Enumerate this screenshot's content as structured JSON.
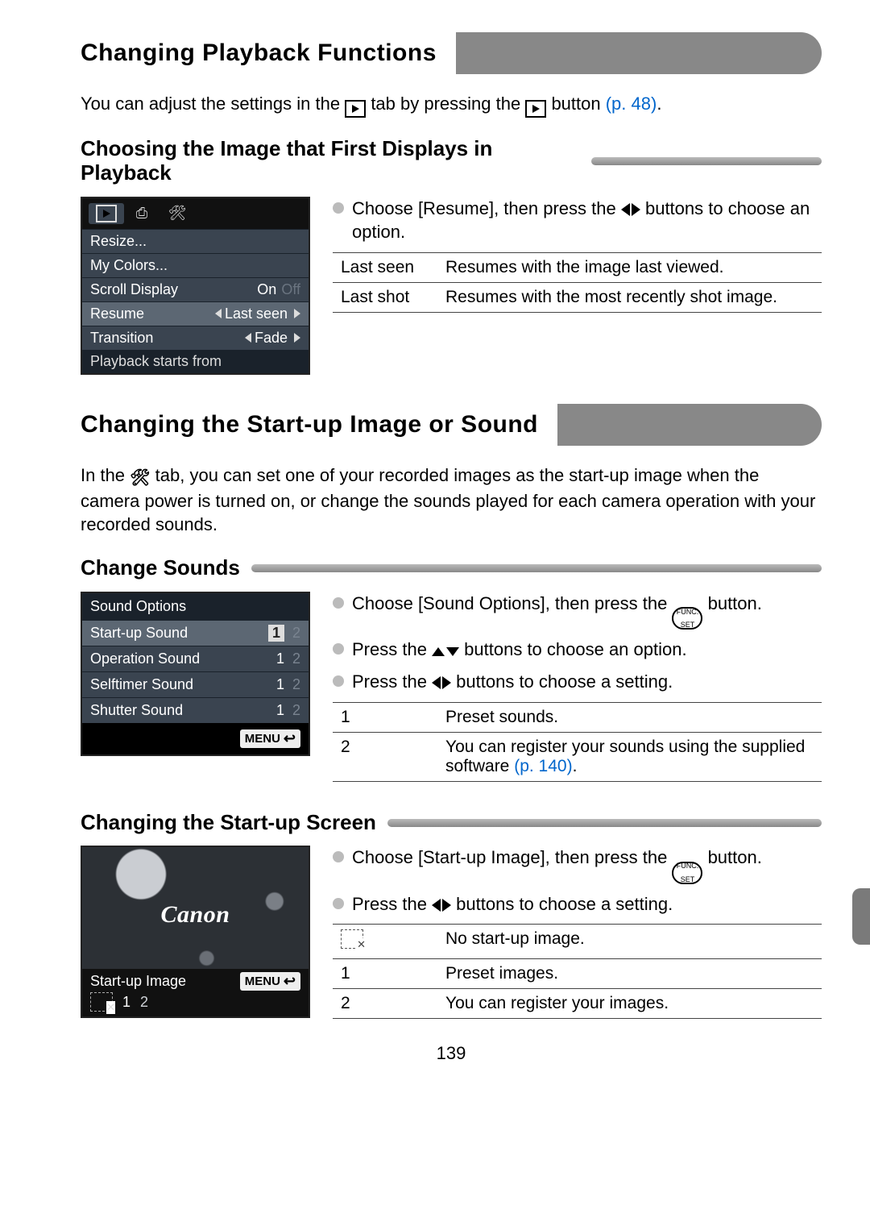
{
  "page_number": "139",
  "section1": {
    "title": "Changing Playback Functions",
    "intro_a": "You can adjust the settings in the ",
    "intro_b": " tab by pressing the ",
    "intro_c": " button ",
    "intro_ref": "(p. 48)",
    "intro_d": "."
  },
  "sub1": {
    "title": "Choosing the Image that First Displays in Playback",
    "bullet_a": "Choose [Resume], then press the ",
    "bullet_b": " buttons to choose an option.",
    "table": [
      {
        "k": "Last seen",
        "v": "Resumes with the image last viewed."
      },
      {
        "k": "Last shot",
        "v": "Resumes with the most recently shot image."
      }
    ],
    "cam": {
      "rows": [
        {
          "label": "Resize...",
          "value": ""
        },
        {
          "label": "My Colors...",
          "value": ""
        },
        {
          "label": "Scroll Display",
          "value_on": "On",
          "value_off": "Off"
        },
        {
          "label": "Resume",
          "value": "Last seen",
          "selected": true,
          "arrows": true
        },
        {
          "label": "Transition",
          "value": "Fade",
          "arrows": true
        }
      ],
      "status": "Playback starts from"
    }
  },
  "section2": {
    "title": "Changing the Start-up Image or Sound",
    "intro_a": "In the ",
    "intro_b": " tab, you can set one of your recorded images as the start-up image when the camera power is turned on, or change the sounds played for each camera operation with your recorded sounds."
  },
  "sub2": {
    "title": "Change Sounds",
    "b1_a": "Choose [Sound Options], then press the ",
    "b1_b": " button.",
    "b2_a": "Press the ",
    "b2_b": " buttons to choose an option.",
    "b3_a": "Press the ",
    "b3_b": " buttons to choose a setting.",
    "table": [
      {
        "k": "1",
        "v": "Preset sounds."
      },
      {
        "k": "2",
        "v_a": "You can register your sounds using the supplied software ",
        "v_ref": "(p. 140)",
        "v_b": "."
      }
    ],
    "cam": {
      "title": "Sound Options",
      "rows": [
        {
          "label": "Start-up Sound",
          "sel": true,
          "n1": "1",
          "n2": "2"
        },
        {
          "label": "Operation Sound",
          "n1": "1",
          "n2": "2"
        },
        {
          "label": "Selftimer Sound",
          "n1": "1",
          "n2": "2"
        },
        {
          "label": "Shutter Sound",
          "n1": "1",
          "n2": "2"
        }
      ],
      "menu": "MENU"
    }
  },
  "sub3": {
    "title": "Changing the Start-up Screen",
    "b1_a": "Choose [Start-up Image], then press the ",
    "b1_b": " button.",
    "b2_a": "Press the ",
    "b2_b": " buttons to choose a setting.",
    "table": [
      {
        "icon": true,
        "v": "No start-up image."
      },
      {
        "k": "1",
        "v": "Preset images."
      },
      {
        "k": "2",
        "v": "You can register your images."
      }
    ],
    "cam": {
      "brand": "Canon",
      "label": "Start-up Image",
      "menu": "MENU",
      "opts": [
        "1",
        "2"
      ]
    }
  },
  "icons": {
    "func": "FUNC.",
    "set": "SET"
  }
}
